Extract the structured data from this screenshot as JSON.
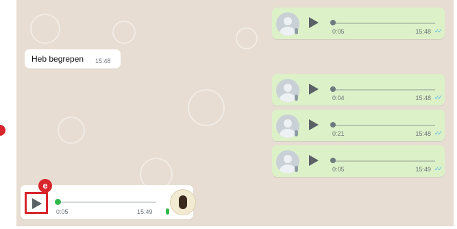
{
  "messages": [
    {
      "kind": "voice",
      "direction": "out",
      "duration": "0:05",
      "time": "15:48",
      "ticks": "✓✓"
    },
    {
      "kind": "text",
      "direction": "in",
      "text": "Heb begrepen",
      "time": "15:48"
    },
    {
      "kind": "voice",
      "direction": "out",
      "duration": "0:04",
      "time": "15:48",
      "ticks": "✓✓"
    },
    {
      "kind": "voice",
      "direction": "out",
      "duration": "0:21",
      "time": "15:48",
      "ticks": "✓✓"
    },
    {
      "kind": "voice",
      "direction": "out",
      "duration": "0:05",
      "time": "15:49",
      "ticks": "✓✓"
    },
    {
      "kind": "voice",
      "direction": "in",
      "duration": "0:05",
      "time": "15:49"
    }
  ],
  "annotation": {
    "label": "e",
    "color": "#d8262c"
  },
  "colors": {
    "chat_bg": "#e7ddd2",
    "out_bubble": "#dcf1c8",
    "in_bubble": "#ffffff",
    "read_ticks": "#4fb5ea",
    "accent_green": "#31b84a"
  }
}
